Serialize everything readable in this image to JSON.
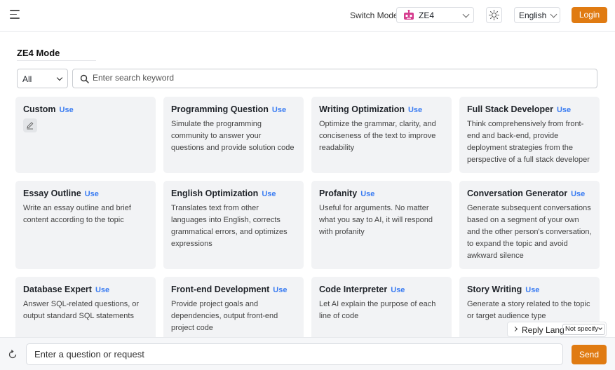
{
  "header": {
    "switch_mode_label": "Switch Mode",
    "mode_value": "ZE4",
    "mode_icon": "robot-icon",
    "theme_icon": "sun-icon",
    "language_value": "English",
    "login_label": "Login",
    "accent_color": "#e07b12"
  },
  "main": {
    "mode_title": "ZE4 Mode",
    "category_value": "All",
    "search_placeholder": "Enter search keyword"
  },
  "use_label": "Use",
  "cards": [
    {
      "title": "Custom",
      "desc": ""
    },
    {
      "title": "Programming Question",
      "desc": "Simulate the programming community to answer your questions and provide solution code"
    },
    {
      "title": "Writing Optimization",
      "desc": "Optimize the grammar, clarity, and conciseness of the text to improve readability"
    },
    {
      "title": "Full Stack Developer",
      "desc": "Think comprehensively from front-end and back-end, provide deployment strategies from the perspective of a full stack developer"
    },
    {
      "title": "Essay Outline",
      "desc": "Write an essay outline and brief content according to the topic"
    },
    {
      "title": "English Optimization",
      "desc": "Translates text from other languages into English, corrects grammatical errors, and optimizes expressions"
    },
    {
      "title": "Profanity",
      "desc": "Useful for arguments. No matter what you say to AI, it will respond with profanity"
    },
    {
      "title": "Conversation Generator",
      "desc": "Generate subsequent conversations based on a segment of your own and the other person's conversation, to expand the topic and avoid awkward silence"
    },
    {
      "title": "Database Expert",
      "desc": "Answer SQL-related questions, or output standard SQL statements"
    },
    {
      "title": "Front-end Development",
      "desc": "Provide project goals and dependencies, output front-end project code"
    },
    {
      "title": "Code Interpreter",
      "desc": "Let AI explain the purpose of each line of code"
    },
    {
      "title": "Story Writing",
      "desc": "Generate a story related to the topic or target audience type"
    }
  ],
  "reply_lang": {
    "label": "Reply Lang",
    "value": "Not specify"
  },
  "composer": {
    "placeholder": "Enter a question or request",
    "send_label": "Send"
  }
}
